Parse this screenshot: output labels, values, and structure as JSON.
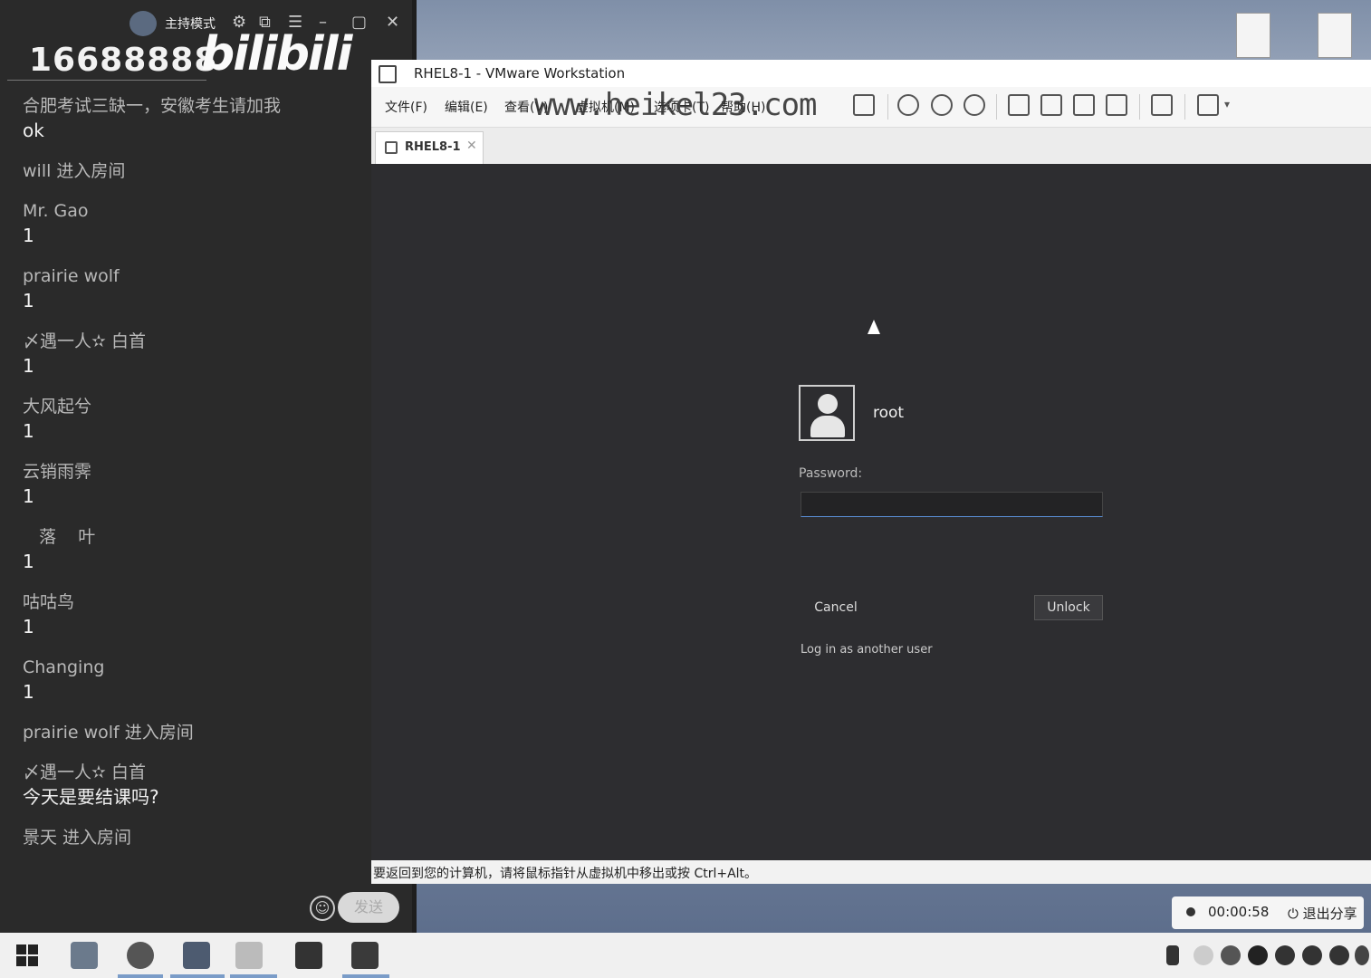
{
  "chat_panel": {
    "host_mode_label": "主持模式",
    "room_number": "16688888",
    "brand_logo": "bilibili",
    "messages": [
      {
        "name": "合肥考试三缺一，安徽考生请加我",
        "text": "ok"
      },
      {
        "name": "will 进入房间",
        "text": ""
      },
      {
        "name": "Mr. Gao",
        "text": "1"
      },
      {
        "name": "prairie wolf",
        "text": "1"
      },
      {
        "name": "〆遇一人✫ 白首",
        "text": "1"
      },
      {
        "name": "大风起兮",
        "text": "1"
      },
      {
        "name": "云销雨霁",
        "text": "1"
      },
      {
        "name": "   落    叶",
        "text": "1"
      },
      {
        "name": "咕咕鸟",
        "text": "1"
      },
      {
        "name": "Changing",
        "text": "1"
      },
      {
        "name": "prairie wolf 进入房间",
        "text": ""
      },
      {
        "name": "〆遇一人✫ 白首",
        "text": "今天是要结课吗?"
      },
      {
        "name": "景天 进入房间",
        "text": ""
      }
    ],
    "send_label": "发送"
  },
  "vmware": {
    "window_title": "RHEL8-1 - VMware Workstation",
    "menu": [
      "文件(F)",
      "编辑(E)",
      "查看(V)",
      "虚拟机(M)",
      "选项卡(T)",
      "帮助(H)"
    ],
    "watermark": "www.heikel23.com",
    "tab_label": "RHEL8-1",
    "status_text": "要返回到您的计算机，请将鼠标指针从虚拟机中移出或按 Ctrl+Alt。"
  },
  "lock_screen": {
    "username": "root",
    "password_label": "Password:",
    "password_value": "",
    "cancel_label": "Cancel",
    "unlock_label": "Unlock",
    "other_user_label": "Log in as another user"
  },
  "share_widget": {
    "timer": "00:00:58",
    "exit_label": "退出分享"
  },
  "colors": {
    "vm_background": "#2d2d30",
    "chat_background": "#2a2a2a",
    "focus_accent": "#5a8fd8"
  }
}
